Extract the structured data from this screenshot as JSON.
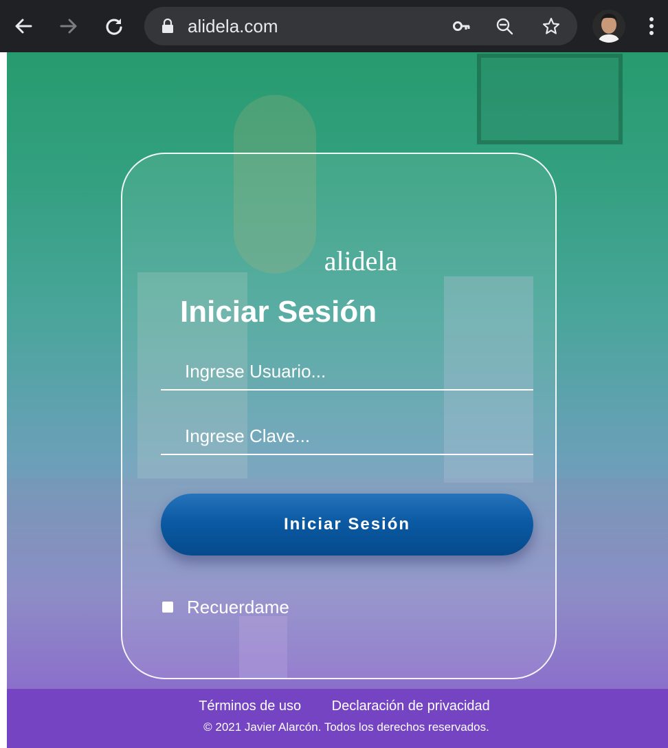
{
  "browser": {
    "url": "alidela.com",
    "icons": {
      "back": "arrow-left-icon",
      "forward": "arrow-right-icon",
      "reload": "reload-icon",
      "lock": "lock-icon",
      "password_key": "key-icon",
      "zoom": "zoom-out-icon",
      "bookmark": "star-icon",
      "menu": "kebab-menu-icon"
    }
  },
  "login": {
    "brand": "alidela",
    "title": "Iniciar Sesión",
    "username_placeholder": "Ingrese Usuario...",
    "password_placeholder": "Ingrese Clave...",
    "submit_label": "Iniciar Sesión",
    "remember_label": "Recuerdame",
    "remember_checked": false
  },
  "footer": {
    "terms": "Términos de uso",
    "privacy": "Declaración de privacidad",
    "copyright": "© 2021 Javier Alarcón. Todos los derechos reservados."
  },
  "colors": {
    "chrome_bar": "#202124",
    "omnibox": "#35363a",
    "gradient_top": "#279b6f",
    "gradient_bottom": "#7a52c4",
    "button": "#0b5aa3",
    "footer": "#7444c2"
  }
}
